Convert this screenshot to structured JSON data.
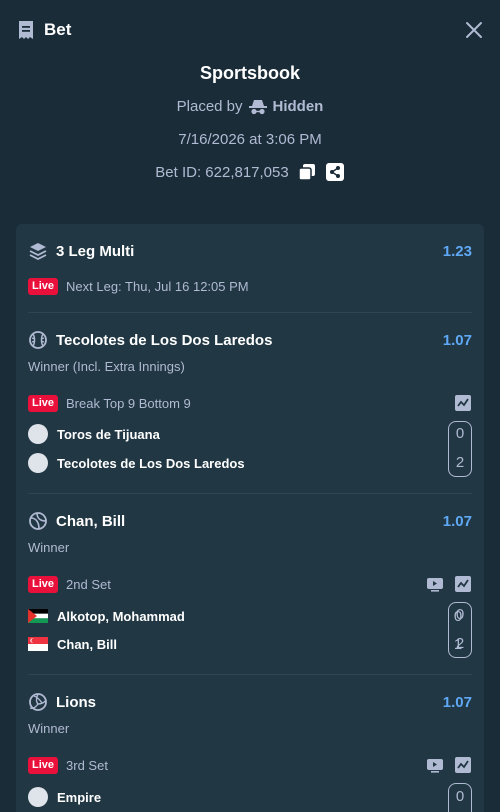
{
  "header": {
    "title": "Bet",
    "close_icon": "close-icon"
  },
  "info": {
    "title": "Sportsbook",
    "placed_by_label": "Placed by",
    "placed_by_value": "Hidden",
    "date": "7/16/2026 at 3:06 PM",
    "bet_id": "Bet ID: 622,817,053"
  },
  "multi": {
    "title": "3 Leg Multi",
    "odds": "1.23",
    "live": "Live",
    "next_leg": "Next Leg: Thu, Jul 16 12:05 PM"
  },
  "legs": [
    {
      "title": "Tecolotes de Los Dos Laredos",
      "odds": "1.07",
      "market": "Winner (Incl. Extra Innings)",
      "live": "Live",
      "status": "Break Top 9 Bottom 9",
      "teams": [
        {
          "name": "Toros de Tijuana",
          "score": "0"
        },
        {
          "name": "Tecolotes de Los Dos Laredos",
          "score": "2"
        }
      ]
    },
    {
      "title": "Chan, Bill",
      "odds": "1.07",
      "market": "Winner",
      "live": "Live",
      "status": "2nd Set",
      "teams": [
        {
          "name": "Alkotop, Mohammad",
          "set": "0",
          "score": "0"
        },
        {
          "name": "Chan, Bill",
          "set": "1",
          "score": "2"
        }
      ]
    },
    {
      "title": "Lions",
      "odds": "1.07",
      "market": "Winner",
      "live": "Live",
      "status": "3rd Set",
      "teams": [
        {
          "name": "Empire",
          "score": "0"
        }
      ]
    }
  ],
  "colors": {
    "background": "#1a2c38",
    "card": "#213743",
    "odds": "#5fa8f5",
    "live": "#e9113c",
    "muted": "#b1bad3"
  }
}
